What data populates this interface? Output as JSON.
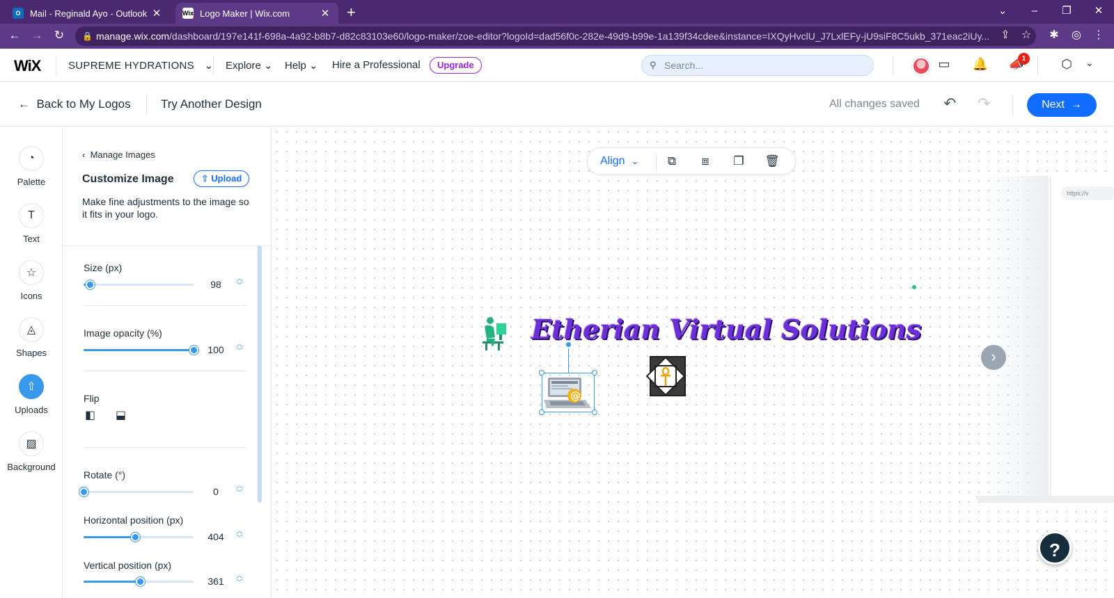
{
  "browser": {
    "tabs": [
      {
        "title": "Mail - Reginald Ayo - Outlook",
        "favicon": "outlook-icon",
        "active": false
      },
      {
        "title": "Logo Maker | Wix.com",
        "favicon": "wix-icon",
        "active": true
      }
    ],
    "url_host": "manage.wix.com",
    "url_path": "/dashboard/197e141f-698a-4a92-b8b7-d82c83103e60/logo-maker/zoe-editor?logoId=dad56f0c-282e-49d9-b99e-1a139f34cdee&instance=IXQyHvclU_J7LxlEFy-jU9siF8C5ukb_371eac2iUy..."
  },
  "wix_header": {
    "logo": "WiX",
    "site_name": "SUPREME HYDRATIONS",
    "nav": [
      "Explore",
      "Help",
      "Hire a Professional"
    ],
    "upgrade_label": "Upgrade",
    "search_placeholder": "Search...",
    "notification_count": "1"
  },
  "editor_bar": {
    "back_label": "Back to My Logos",
    "try_label": "Try Another Design",
    "saved_status": "All changes saved",
    "next_label": "Next"
  },
  "rail": [
    {
      "label": "Palette",
      "icon": "palette-icon"
    },
    {
      "label": "Text",
      "icon": "text-icon"
    },
    {
      "label": "Icons",
      "icon": "star-icon"
    },
    {
      "label": "Shapes",
      "icon": "shapes-icon"
    },
    {
      "label": "Uploads",
      "icon": "upload-icon",
      "active": true
    },
    {
      "label": "Background",
      "icon": "background-icon"
    }
  ],
  "panel": {
    "back_label": "Manage Images",
    "title": "Customize Image",
    "upload_label": "Upload",
    "description": "Make fine adjustments to the image so it fits in your logo.",
    "size_label": "Size (px)",
    "size_value": "98",
    "opacity_label": "Image opacity (%)",
    "opacity_value": "100",
    "flip_label": "Flip",
    "rotate_label": "Rotate (°)",
    "rotate_value": "0",
    "hpos_label": "Horizontal position (px)",
    "hpos_value": "404",
    "vpos_label": "Vertical position (px)",
    "vpos_value": "361"
  },
  "canvas": {
    "align_label": "Align",
    "logo_text": "Etherian Virtual Solutions",
    "side_url": "https://v"
  },
  "colors": {
    "accent": "#116dff",
    "brand_purple": "#4b2970",
    "upgrade": "#9a27d5",
    "logo_text": "#6d2fd6"
  }
}
